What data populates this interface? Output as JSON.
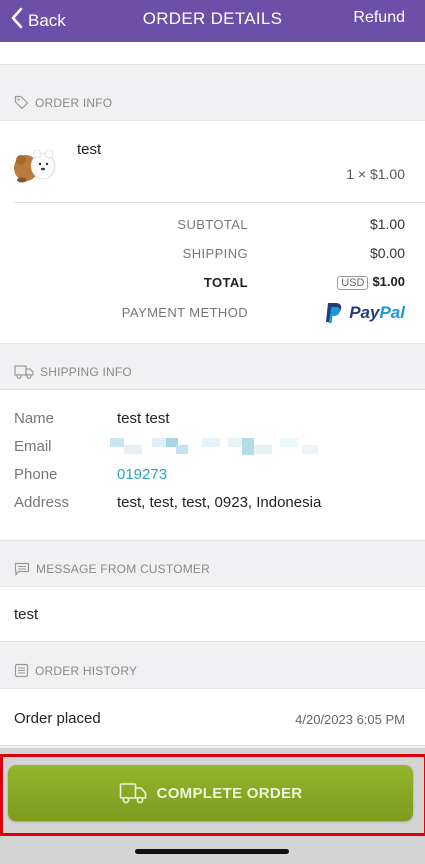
{
  "nav": {
    "back_label": "Back",
    "title": "ORDER DETAILS",
    "refund_label": "Refund",
    "color": "#6c4fa8"
  },
  "order_info": {
    "heading": "ORDER INFO",
    "product": {
      "name": "test",
      "qty_price": "1 × $1.00"
    },
    "summary": {
      "subtotal_label": "SUBTOTAL",
      "subtotal": "$1.00",
      "shipping_label": "SHIPPING",
      "shipping": "$0.00",
      "total_label": "TOTAL",
      "currency": "USD",
      "total": "$1.00",
      "payment_label": "PAYMENT METHOD",
      "payment_brand": "PayPal"
    }
  },
  "shipping_info": {
    "heading": "SHIPPING INFO",
    "name_label": "Name",
    "name": "test test",
    "email_label": "Email",
    "phone_label": "Phone",
    "phone": "019273",
    "address_label": "Address",
    "address": "test, test, test, 0923, Indonesia"
  },
  "message": {
    "heading": "MESSAGE FROM CUSTOMER",
    "text": "test"
  },
  "history": {
    "heading": "ORDER HISTORY",
    "event": "Order placed",
    "date": "4/20/2023 6:05 PM"
  },
  "action": {
    "complete_label": "COMPLETE ORDER",
    "color": "#8aab27",
    "highlight_color": "#e0000b"
  }
}
